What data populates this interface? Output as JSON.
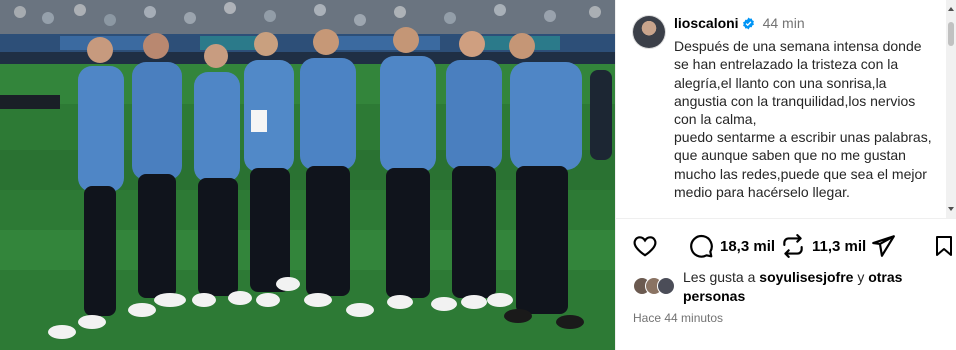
{
  "post": {
    "username": "lioscaloni",
    "time_ago": "44 min",
    "caption": "Después de una semana intensa donde se han entrelazado la tristeza con la alegría,el llanto con una sonrisa,la angustia con la tranquilidad,los nervios con la calma,\npuedo sentarme a escribir unas palabras,\nque aunque saben que no me gustan mucho las redes,puede que sea el mejor medio para hacérselo llegar.",
    "comments_count": "18,3 mil",
    "reposts_count": "11,3 mil",
    "likes_prefix": "Les gusta a",
    "likes_user": "soyulisesjofre",
    "likes_and": "y",
    "likes_others": "otras personas",
    "timestamp": "Hace 44 minutos"
  },
  "icons": {
    "verified": "verified-badge-icon",
    "like": "heart-icon",
    "comment": "comment-bubble-icon",
    "repost": "repost-icon",
    "share": "paper-plane-icon",
    "save": "bookmark-icon"
  },
  "colors": {
    "verified": "#0095f6",
    "text": "#262626",
    "muted": "#737373",
    "pitch": "#2d7a35",
    "jersey": "#4f86c6"
  }
}
